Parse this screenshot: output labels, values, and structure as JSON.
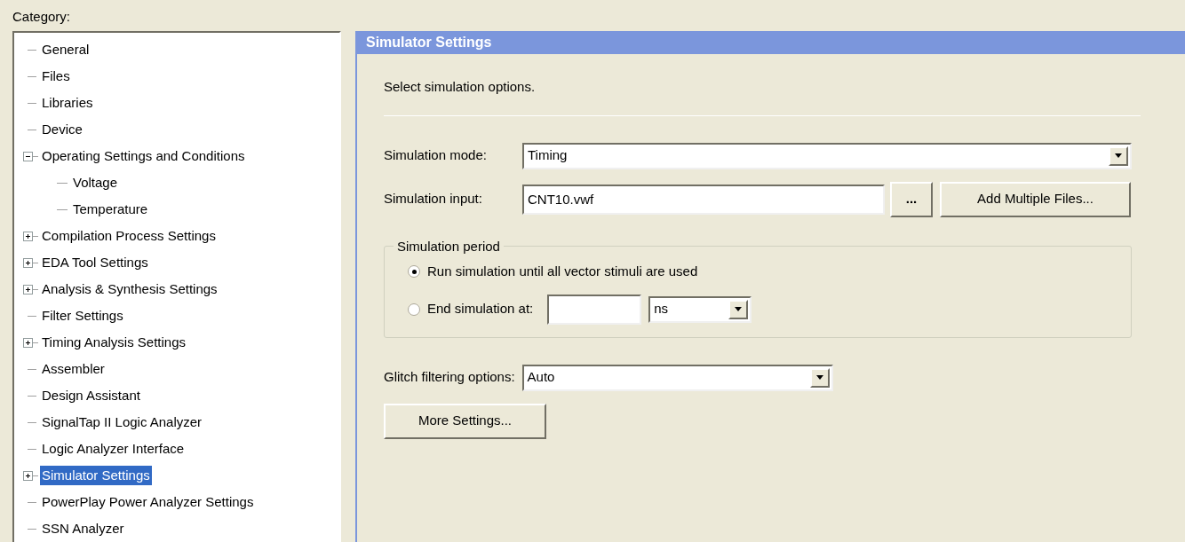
{
  "category_label": "Category:",
  "tree": [
    {
      "label": "General",
      "selected": false
    },
    {
      "label": "Files",
      "selected": false
    },
    {
      "label": "Libraries",
      "selected": false
    },
    {
      "label": "Device",
      "selected": false
    },
    {
      "label": "Operating Settings and Conditions",
      "selected": false,
      "expanded": true,
      "children": [
        {
          "label": "Voltage",
          "selected": false
        },
        {
          "label": "Temperature",
          "selected": false
        }
      ]
    },
    {
      "label": "Compilation Process Settings",
      "selected": false,
      "expanded": false
    },
    {
      "label": "EDA Tool Settings",
      "selected": false,
      "expanded": false
    },
    {
      "label": "Analysis & Synthesis Settings",
      "selected": false,
      "expanded": false
    },
    {
      "label": "Filter Settings",
      "selected": false
    },
    {
      "label": "Timing Analysis Settings",
      "selected": false,
      "expanded": false
    },
    {
      "label": "Assembler",
      "selected": false
    },
    {
      "label": "Design Assistant",
      "selected": false
    },
    {
      "label": "SignalTap II Logic Analyzer",
      "selected": false
    },
    {
      "label": "Logic Analyzer Interface",
      "selected": false
    },
    {
      "label": "Simulator Settings",
      "selected": true,
      "expanded": false
    },
    {
      "label": "PowerPlay Power Analyzer Settings",
      "selected": false
    },
    {
      "label": "SSN Analyzer",
      "selected": false
    }
  ],
  "panel": {
    "title": "Simulator Settings",
    "description": "Select simulation options.",
    "mode": {
      "label": "Simulation mode:",
      "value": "Timing"
    },
    "input": {
      "label": "Simulation input:",
      "value": "CNT10.vwf",
      "browse": "...",
      "add_button": "Add Multiple Files..."
    },
    "period": {
      "legend": "Simulation period",
      "options": [
        {
          "kind": "plain",
          "label": "Run simulation until all vector stimuli are used",
          "selected": true
        },
        {
          "kind": "time",
          "label": "End simulation at:",
          "selected": false,
          "unit": "ns"
        }
      ]
    },
    "glitch": {
      "label": "Glitch filtering options:",
      "value": "Auto"
    },
    "more_button": "More Settings..."
  }
}
